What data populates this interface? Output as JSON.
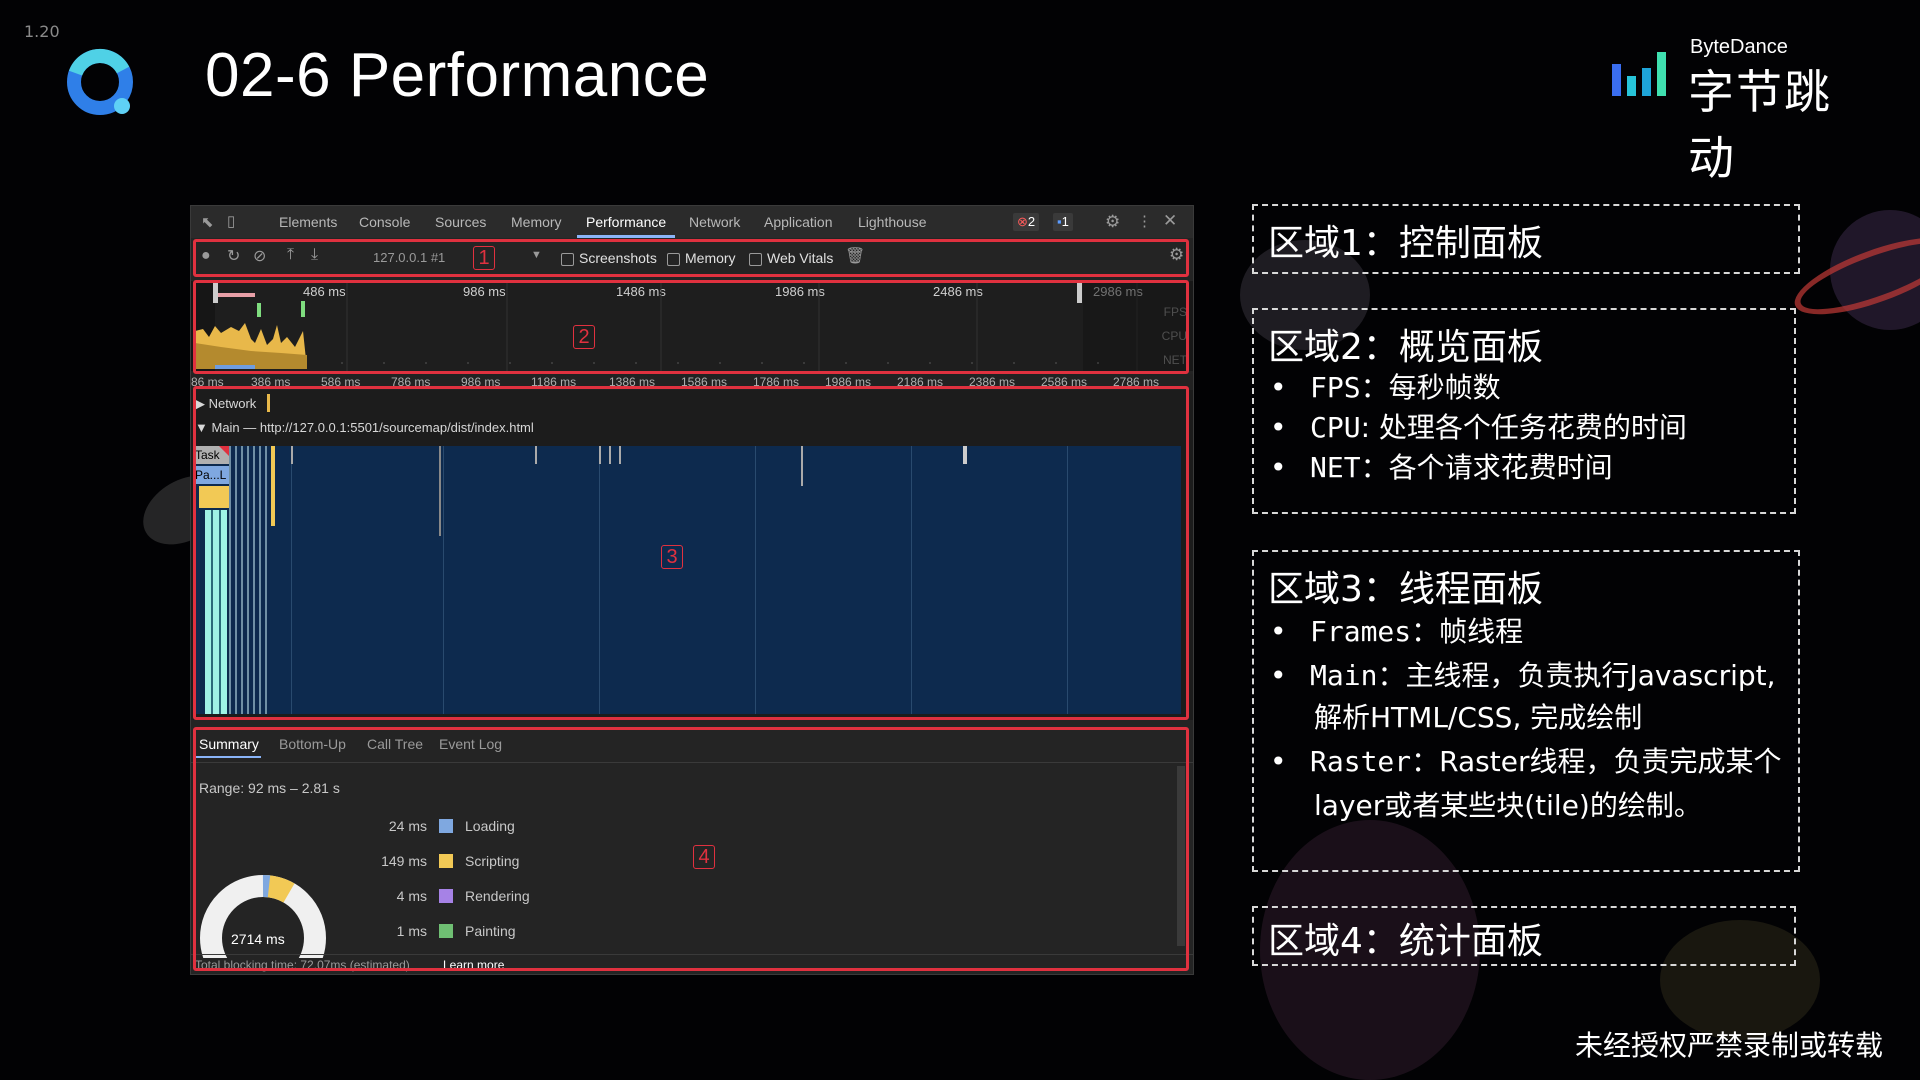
{
  "slide": {
    "number": "1.20",
    "title": "02-6 Performance",
    "brand_en": "ByteDance",
    "brand_cn": "字节跳动",
    "footer": "未经授权严禁录制或转载"
  },
  "devtools": {
    "tabs": [
      "Elements",
      "Console",
      "Sources",
      "Memory",
      "Performance",
      "Network",
      "Application",
      "Lighthouse"
    ],
    "active_tab": "Performance",
    "error_count": "2",
    "message_count": "1",
    "target": "127.0.0.1 #1",
    "checkboxes": [
      "Screenshots",
      "Memory",
      "Web Vitals"
    ],
    "region_numbers": [
      "1",
      "2",
      "3",
      "4"
    ],
    "overview_ticks": [
      "486 ms",
      "986 ms",
      "1486 ms",
      "1986 ms",
      "2486 ms",
      "2986 ms"
    ],
    "overview_labels": [
      "FPS",
      "CPU",
      "NET"
    ],
    "detail_ticks": [
      "86 ms",
      "386 ms",
      "586 ms",
      "786 ms",
      "986 ms",
      "1186 ms",
      "1386 ms",
      "1586 ms",
      "1786 ms",
      "1986 ms",
      "2186 ms",
      "2386 ms",
      "2586 ms",
      "2786 ms"
    ],
    "tracks": {
      "network": "Network",
      "main": "Main — http://127.0.0.1:5501/sourcemap/dist/index.html",
      "task": "Task",
      "parse": "Pa...L"
    },
    "bottom_tabs": [
      "Summary",
      "Bottom-Up",
      "Call Tree",
      "Event Log"
    ],
    "range": "Range: 92 ms – 2.81 s",
    "total_ms": "2714 ms",
    "summary": [
      {
        "value": "24 ms",
        "name": "Loading",
        "color": "#7fa8e0"
      },
      {
        "value": "149 ms",
        "name": "Scripting",
        "color": "#f2c955"
      },
      {
        "value": "4 ms",
        "name": "Rendering",
        "color": "#a682e6"
      },
      {
        "value": "1 ms",
        "name": "Painting",
        "color": "#6fbf73"
      }
    ],
    "footer_text": "Total blocking time: 72.07ms (estimated)",
    "footer_link": "Learn more"
  },
  "panels": {
    "p1": {
      "title": "区域1：控制面板"
    },
    "p2": {
      "title": "区域2：概览面板",
      "items": [
        {
          "kw": "FPS",
          "text": "：每秒帧数"
        },
        {
          "kw": "CPU",
          "text": ": 处理各个任务花费的时间"
        },
        {
          "kw": "NET",
          "text": "：各个请求花费时间"
        }
      ]
    },
    "p3": {
      "title": "区域3：线程面板",
      "items": [
        {
          "kw": "Frames",
          "text": "：帧线程"
        },
        {
          "kw": "Main",
          "text": "：主线程，负责执行Javascript,",
          "cont": "解析HTML/CSS, 完成绘制"
        },
        {
          "kw": "Raster",
          "text": "：Raster线程，负责完成某个",
          "cont": "layer或者某些块(tile)的绘制。"
        }
      ]
    },
    "p4": {
      "title": "区域4：统计面板"
    }
  },
  "colors": {
    "region_border": "#e0313f",
    "main_track_bg": "#0d2a4e",
    "accent_tab": "#8ab4f8"
  }
}
